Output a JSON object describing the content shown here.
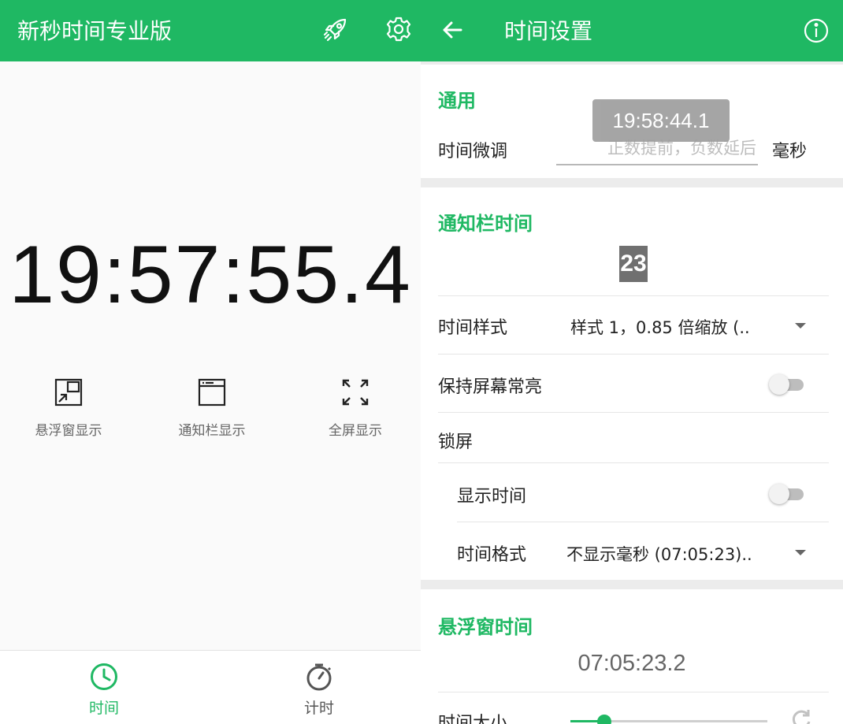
{
  "left": {
    "app_title": "新秒时间专业版",
    "clock": "19:57:55.4",
    "modes": [
      {
        "label": "悬浮窗显示",
        "icon": "floating-window-icon"
      },
      {
        "label": "通知栏显示",
        "icon": "browser-window-icon"
      },
      {
        "label": "全屏显示",
        "icon": "fullscreen-icon"
      }
    ],
    "nav": [
      {
        "label": "时间",
        "icon": "clock-icon",
        "active": true
      },
      {
        "label": "计时",
        "icon": "stopwatch-icon",
        "active": false
      }
    ],
    "toolbar_icons": [
      "rocket-icon",
      "gear-icon"
    ]
  },
  "right": {
    "title": "时间设置",
    "toolbar_icons": [
      "back-arrow-icon",
      "info-icon"
    ],
    "general": {
      "section": "通用",
      "adjust_label": "时间微调",
      "adjust_placeholder": "正数提前，负数延后",
      "unit": "毫秒",
      "toast": "19:58:44.1"
    },
    "notif": {
      "section": "通知栏时间",
      "preview": "23",
      "style_label": "时间样式",
      "style_value": "样式 1，0.85 倍缩放 (..",
      "keep_screen_label": "保持屏幕常亮",
      "keep_screen_on": false,
      "lock_label": "锁屏",
      "show_time_label": "显示时间",
      "show_time_on": false,
      "format_label": "时间格式",
      "format_value": "不显示毫秒 (07:05:23).."
    },
    "float": {
      "section": "悬浮窗时间",
      "preview": "07:05:23.2",
      "size_label": "时间大小",
      "size_level": 0.17
    }
  },
  "colors": {
    "accent": "#1fb863",
    "background": "#fafafa",
    "card": "#ffffff"
  }
}
